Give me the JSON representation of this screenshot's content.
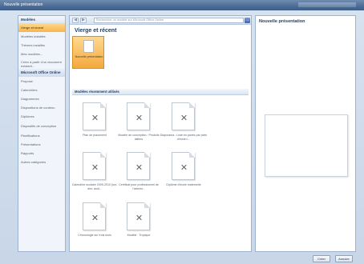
{
  "window": {
    "title": "Nouvelle présentation"
  },
  "sidebar": {
    "header": "Modèles",
    "items": [
      {
        "label": "Vierge et récent",
        "selected": true
      },
      {
        "label": "Modèles installés"
      },
      {
        "label": "Thèmes installés"
      },
      {
        "label": "Mes modèles..."
      },
      {
        "label": "Créer à partir d'un document existant..."
      }
    ],
    "section": "Microsoft Office Online",
    "online_items": [
      "Proposé",
      "Calendriers",
      "Diagrammes",
      "Dispositions de contenu",
      "Diplômes",
      "Dispositifs de conception",
      "Planifications",
      "Présentations",
      "Rapports",
      "Autres catégories"
    ]
  },
  "toolbar": {
    "back_icon": "back-arrow-icon",
    "forward_icon": "forward-arrow-icon",
    "search_placeholder": "Rechercher un modèle sur Microsoft Office Online"
  },
  "center": {
    "title": "Vierge et récent",
    "blank_label": "Nouvelle présentation",
    "recent_section": "Modèles récemment utilisés",
    "templates": [
      "Plan de placement",
      "Modèle de conception : Produits laitiers",
      "Diaporama : Liste en pavés par plein d'écran l...",
      "Calendrier scolaire 2009-2010 (lun-dim; août...",
      "Certificat pour professionnel de l'admini...",
      "Diplôme d'école maternelle",
      "Chronologie sur trois mois",
      "Modèle : Tropique"
    ]
  },
  "preview": {
    "title": "Nouvelle présentation"
  },
  "buttons": {
    "create": "Créer",
    "cancel": "Annuler"
  }
}
